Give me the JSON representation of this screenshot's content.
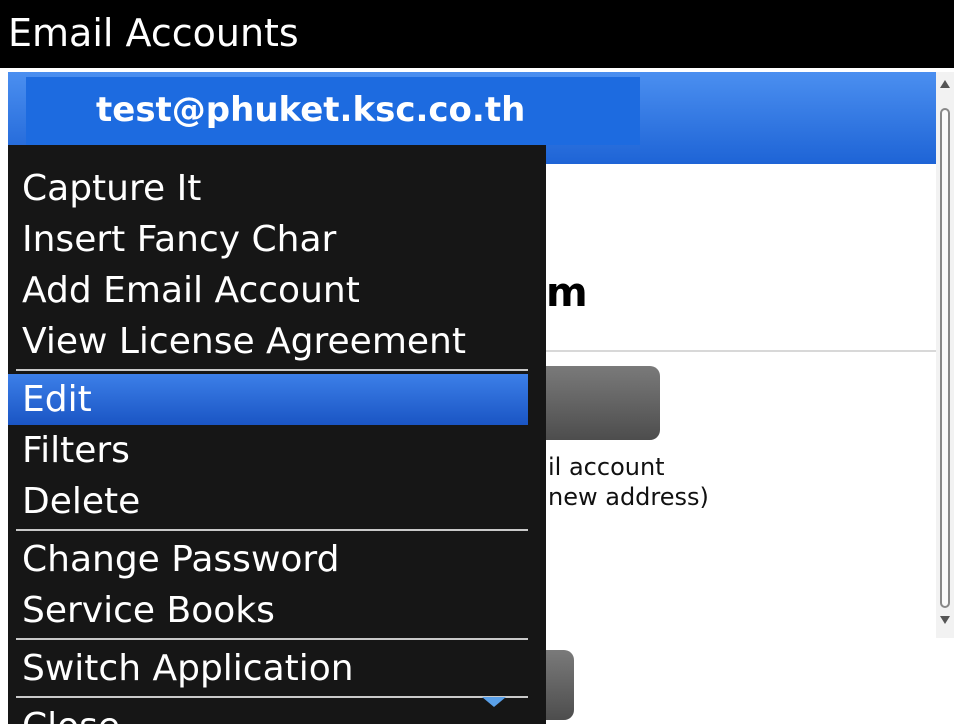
{
  "window": {
    "title": "Email Accounts"
  },
  "account_header": {
    "email": "test@phuket.ksc.co.th"
  },
  "background": {
    "account_name_fragment": "m",
    "description_line1": "il account",
    "description_line2": "new address)"
  },
  "menu": {
    "items": [
      {
        "label": "Capture It"
      },
      {
        "label": "Insert Fancy Char"
      },
      {
        "label": "Add Email Account"
      },
      {
        "label": "View License Agreement"
      },
      {
        "label": "Edit",
        "selected": true
      },
      {
        "label": "Filters"
      },
      {
        "label": "Delete"
      },
      {
        "label": "Change Password"
      },
      {
        "label": "Service Books"
      },
      {
        "label": "Switch Application"
      },
      {
        "label": "Close"
      }
    ],
    "more_indicator_icon": "chevron-down-icon"
  },
  "colors": {
    "selection": "#1d6be0",
    "menu_background": "#161616",
    "title_bar": "#000000"
  }
}
